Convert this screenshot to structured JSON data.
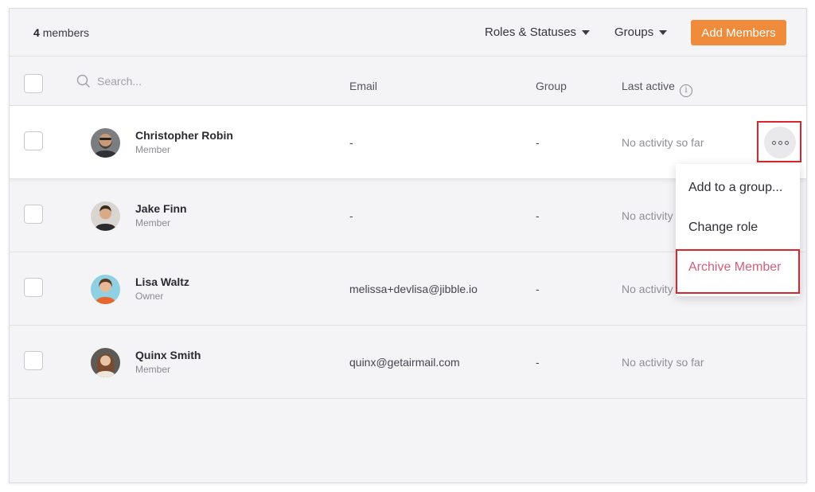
{
  "header": {
    "member_count": "4",
    "member_word": "members",
    "filters": [
      "Roles & Statuses",
      "Groups"
    ],
    "add_button": "Add Members"
  },
  "table": {
    "search_placeholder": "Search...",
    "columns": {
      "email": "Email",
      "group": "Group",
      "last_active": "Last active"
    }
  },
  "members": [
    {
      "name": "Christopher Robin",
      "role": "Member",
      "email": "-",
      "group": "-",
      "last_active": "No activity so far"
    },
    {
      "name": "Jake Finn",
      "role": "Member",
      "email": "-",
      "group": "-",
      "last_active": "No activity"
    },
    {
      "name": "Lisa Waltz",
      "role": "Owner",
      "email": "melissa+devlisa@jibble.io",
      "group": "-",
      "last_active": "No activity"
    },
    {
      "name": "Quinx Smith",
      "role": "Member",
      "email": "quinx@getairmail.com",
      "group": "-",
      "last_active": "No activity so far"
    }
  ],
  "context_menu": {
    "items": [
      "Add to a group...",
      "Change role",
      "Archive Member"
    ]
  },
  "colors": {
    "accent": "#f08b3c",
    "archive_text": "#d35f79",
    "highlight_box": "#d9262c"
  },
  "icons": [
    "search-icon",
    "info-icon",
    "caret-down-icon",
    "more-options-icon"
  ]
}
